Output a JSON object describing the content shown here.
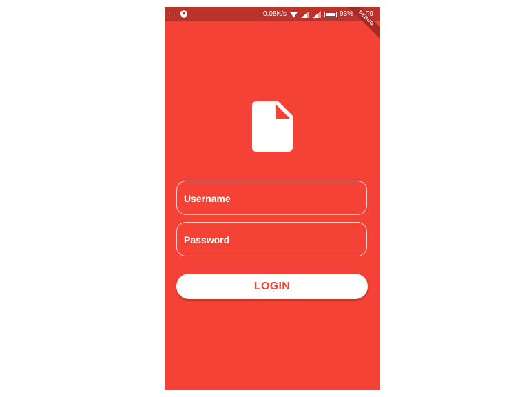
{
  "status_bar": {
    "notification_dots": "···",
    "network_speed": "0.08K/s",
    "battery_percent": "93%",
    "time": "07:09"
  },
  "debug_banner": {
    "label": "DEBUG"
  },
  "login_form": {
    "username_label": "Username",
    "password_label": "Password",
    "login_button_label": "LOGIN"
  },
  "colors": {
    "background": "#f44336",
    "status_bar": "#b9322b",
    "button_background": "#ffffff",
    "button_text": "#f44336",
    "field_border": "#ffd1cc"
  },
  "icons": {
    "status_left": "shield-icon",
    "logo": "document-icon"
  }
}
